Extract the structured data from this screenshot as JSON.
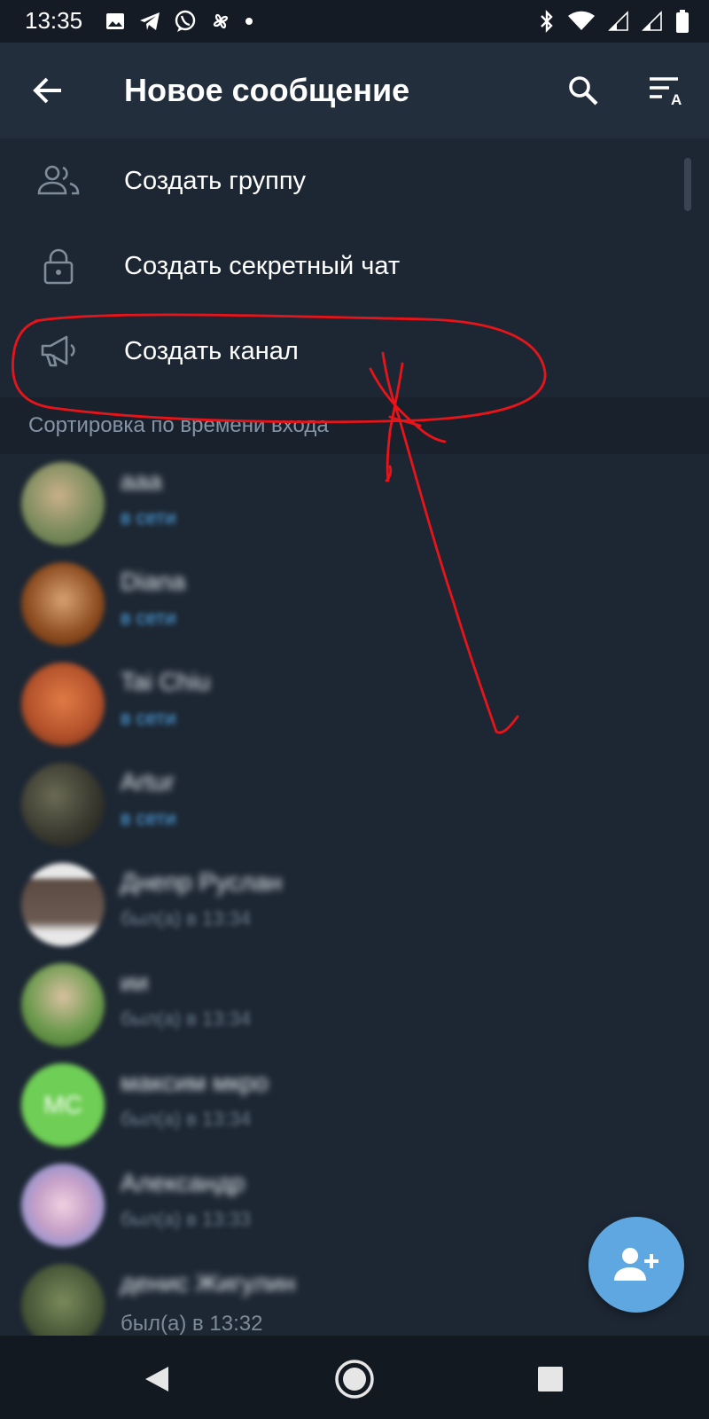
{
  "status_bar": {
    "time": "13:35",
    "left_icons": [
      "gallery-icon",
      "telegram-icon",
      "viber-icon",
      "pinwheel-icon",
      "dot-icon"
    ],
    "right_icons": [
      "bluetooth-icon",
      "wifi-icon",
      "signal-icon",
      "signal-icon",
      "battery-icon"
    ]
  },
  "app_bar": {
    "title": "Новое сообщение",
    "back_icon": "arrow-left-icon",
    "search_icon": "search-icon",
    "sort_icon": "sort-alpha-icon"
  },
  "menu": {
    "items": [
      {
        "label": "Создать группу",
        "icon": "group-icon"
      },
      {
        "label": "Создать секретный чат",
        "icon": "lock-icon"
      },
      {
        "label": "Создать канал",
        "icon": "megaphone-icon"
      }
    ]
  },
  "section": {
    "label": "Сортировка по времени входа"
  },
  "contacts": [
    {
      "name": "aaa",
      "status": "в сети",
      "online": true,
      "avatar_color": "#7a8a5c"
    },
    {
      "name": "Diana",
      "status": "в сети",
      "online": true,
      "avatar_color": "#8a4a1e"
    },
    {
      "name": "Tai Chiu",
      "status": "в сети",
      "online": true,
      "avatar_color": "#b5532c"
    },
    {
      "name": "Artur",
      "status": "в сети",
      "online": true,
      "avatar_color": "#3a3a30"
    },
    {
      "name": "Днепр Руслан",
      "status": "был(а) в 13:34",
      "online": false,
      "avatar_color": "#6a5a52"
    },
    {
      "name": "ии",
      "status": "был(а) в 13:34",
      "online": false,
      "avatar_color": "#6d9a4e"
    },
    {
      "name": "максим мкро",
      "status": "был(а) в 13:34",
      "online": false,
      "avatar_color": "#6fce55",
      "initials": "МС"
    },
    {
      "name": "Александр",
      "status": "был(а) в 13:33",
      "online": false,
      "avatar_color": "#c6a0c8"
    },
    {
      "name": "денис Жигулин",
      "status": "был(а) в 13:32",
      "online": false,
      "avatar_color": "#4a5a3a"
    }
  ],
  "fab": {
    "icon": "add-contact-icon"
  },
  "nav_bar": {
    "icons": [
      "nav-back-icon",
      "nav-home-icon",
      "nav-recents-icon"
    ]
  },
  "colors": {
    "background": "#1d2733",
    "app_bar": "#232e3c",
    "accent": "#5ea7e0",
    "online": "#4fa6e8",
    "annotation": "#e8141a"
  }
}
